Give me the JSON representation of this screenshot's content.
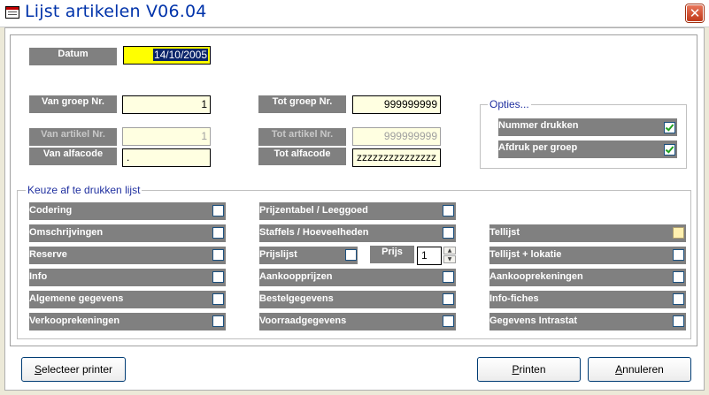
{
  "window": {
    "title": "Lijst artikelen V06.04",
    "close_glyph": "✕"
  },
  "fields": {
    "datum_label": "Datum",
    "datum_value": "14/10/2005",
    "van_groep_label": "Van groep Nr.",
    "van_groep_value": "1",
    "tot_groep_label": "Tot groep Nr.",
    "tot_groep_value": "999999999",
    "van_artikel_label": "Van artikel Nr.",
    "van_artikel_value": "1",
    "tot_artikel_label": "Tot artikel Nr.",
    "tot_artikel_value": "999999999",
    "van_alfacode_label": "Van alfacode",
    "van_alfacode_value": ".",
    "tot_alfacode_label": "Tot alfacode",
    "tot_alfacode_value": "zzzzzzzzzzzzzzz"
  },
  "options": {
    "title": "Opties...",
    "items": [
      {
        "label": "Nummer drukken",
        "checked": true
      },
      {
        "label": "Afdruk per groep",
        "checked": true
      }
    ]
  },
  "keuze": {
    "title": "Keuze af te drukken lijst",
    "col1": [
      {
        "label": "Codering",
        "checked": false
      },
      {
        "label": "Omschrijvingen",
        "checked": false
      },
      {
        "label": "Reserve",
        "checked": false
      },
      {
        "label": "Info",
        "checked": false
      },
      {
        "label": "Algemene gegevens",
        "checked": false
      },
      {
        "label": "Verkooprekeningen",
        "checked": false
      }
    ],
    "col2": [
      {
        "label": "Prijzentabel / Leeggoed",
        "checked": false
      },
      {
        "label": "Staffels / Hoeveelheden",
        "checked": false
      },
      {
        "label": "Prijslijst",
        "checked": false
      },
      {
        "label": "Aankoopprijzen",
        "checked": false
      },
      {
        "label": "Bestelgegevens",
        "checked": false
      },
      {
        "label": "Voorraadgegevens",
        "checked": false
      }
    ],
    "prijs_label": "Prijs",
    "prijs_value": "1",
    "col3": [
      {
        "label": "Tellijst",
        "checked": false
      },
      {
        "label": "Tellijst + lokatie",
        "checked": false
      },
      {
        "label": "Aankooprekeningen",
        "checked": false
      },
      {
        "label": "Info-fiches",
        "checked": false
      },
      {
        "label": "Gegevens Intrastat",
        "checked": false
      }
    ]
  },
  "buttons": {
    "select_printer_accel": "S",
    "select_printer_rest": "electeer printer",
    "print_accel": "P",
    "print_rest": "rinten",
    "cancel_accel": "A",
    "cancel_rest": "nnuleren"
  }
}
